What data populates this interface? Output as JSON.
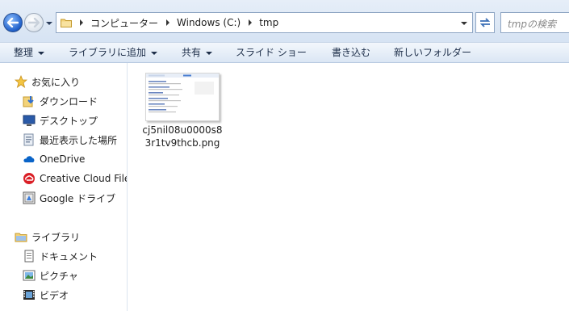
{
  "address": {
    "crumbs": [
      "コンピューター",
      "Windows (C:)",
      "tmp"
    ]
  },
  "search": {
    "placeholder": "tmpの検索"
  },
  "toolbar": {
    "organize": "整理",
    "add_to_library": "ライブラリに追加",
    "share": "共有",
    "slideshow": "スライド ショー",
    "burn": "書き込む",
    "new_folder": "新しいフォルダー"
  },
  "sidebar": {
    "favorites": {
      "label": "お気に入り",
      "items": [
        {
          "label": "ダウンロード",
          "icon": "download-folder-icon"
        },
        {
          "label": "デスクトップ",
          "icon": "desktop-icon"
        },
        {
          "label": "最近表示した場所",
          "icon": "recent-places-icon"
        },
        {
          "label": "OneDrive",
          "icon": "onedrive-icon"
        },
        {
          "label": "Creative Cloud File",
          "icon": "creative-cloud-icon"
        },
        {
          "label": "Google ドライブ",
          "icon": "google-drive-icon"
        }
      ]
    },
    "libraries": {
      "label": "ライブラリ",
      "items": [
        {
          "label": "ドキュメント",
          "icon": "documents-icon"
        },
        {
          "label": "ピクチャ",
          "icon": "pictures-icon"
        },
        {
          "label": "ビデオ",
          "icon": "videos-icon"
        }
      ]
    }
  },
  "files": [
    {
      "name_line1": "cj5nil08u0000s8",
      "name_line2": "3r1tv9thcb.png"
    }
  ],
  "colors": {
    "toolbar_bg": "#dbe6f4",
    "address_border": "#8fa6c4",
    "back_button": "#1f5fc9"
  }
}
